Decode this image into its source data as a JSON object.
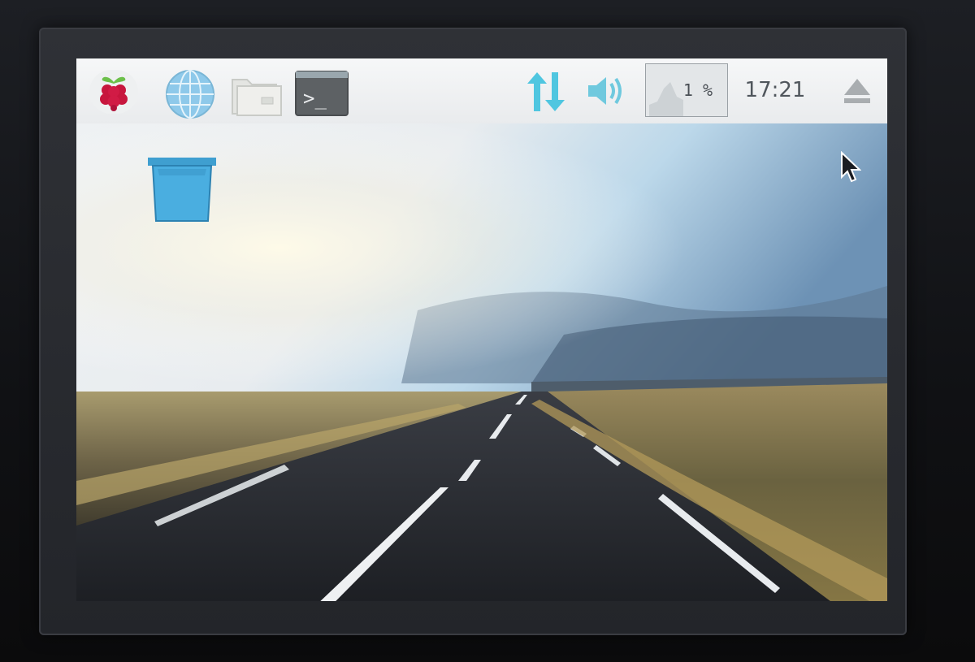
{
  "taskbar": {
    "menu_icon": "raspberry-pi-menu-icon",
    "browser_icon": "globe-icon",
    "files_icon": "folder-icon",
    "terminal_icon": "terminal-icon",
    "terminal_prompt": ">_",
    "network_icon": "network-up-down-arrows-icon",
    "volume_icon": "speaker-volume-icon",
    "cpu_usage": "1 %",
    "clock": "17:21",
    "eject_icon": "eject-icon"
  },
  "desktop": {
    "trash_icon": "wastebasket-icon",
    "wallpaper": "road-to-horizon-landscape",
    "cursor": "mouse-pointer-icon"
  },
  "colors": {
    "taskbar_bg": "#f0f2f3",
    "accent_cyan": "#4fc6e0",
    "trash_blue": "#3aa4d8",
    "clock_text": "#50565c"
  }
}
